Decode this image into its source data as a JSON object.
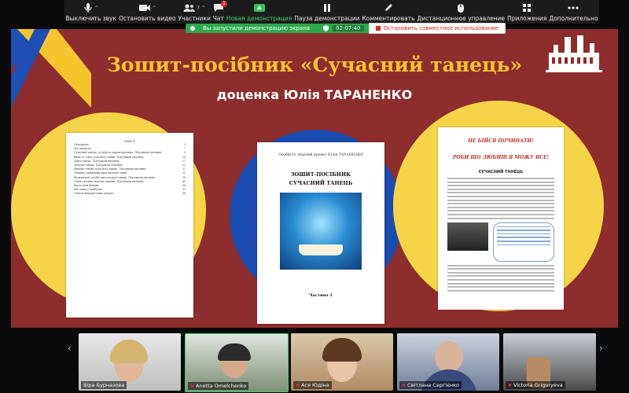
{
  "toolbar": {
    "items": [
      {
        "label": "Выключить звук",
        "icon": "microphone-icon"
      },
      {
        "label": "Остановить видео",
        "icon": "camera-icon"
      },
      {
        "label": "Участники",
        "icon": "participants-icon",
        "count": "7"
      },
      {
        "label": "Чат",
        "icon": "chat-icon",
        "badge": "1"
      },
      {
        "label": "Новая демонстрация",
        "icon": "share-screen-icon"
      },
      {
        "label": "Пауза демонстрации",
        "icon": "pause-icon"
      },
      {
        "label": "Комментировать",
        "icon": "annotate-icon"
      },
      {
        "label": "Дистанционное управление",
        "icon": "remote-control-icon"
      },
      {
        "label": "Приложения",
        "icon": "apps-icon"
      },
      {
        "label": "Дополнительно",
        "icon": "more-icon"
      }
    ]
  },
  "sharebar": {
    "status": "Вы запустили демонстрацию экрана",
    "timer": "02:07:40",
    "stop_label": "Остановить совместное использование"
  },
  "slide": {
    "title": "Зошит-посібник «Сучасний танець»",
    "subtitle": "доценка Юлія ТАРАНЕНКО",
    "colors": {
      "background": "#8e2d2d",
      "title": "#f6c52e",
      "circle_yellow": "#f6d447",
      "circle_blue": "#1b4cb0"
    },
    "toc": {
      "heading": "ЗМІСТ",
      "lines": [
        [
          "Передмова",
          "3"
        ],
        [
          "Мої джерела",
          "7"
        ],
        [
          "Сучасний танець: історія та характеристика. Підсумкові питання",
          "9"
        ],
        [
          "Види та стилі сучасного танцю. Підсумкові питання",
          "14"
        ],
        [
          "Джаз-танець. Підсумкові питання",
          "17"
        ],
        [
          "Модерн-танець. Підсумкові питання",
          "22"
        ],
        [
          "Фізичні основи сучасного танцю. Підсумкові питання",
          "27"
        ],
        [
          "Техніки і принципи джаз-модерн танцю",
          "31"
        ],
        [
          "Виражальні засоби джаз-модерн танцю. Підсумкові питання",
          "38"
        ],
        [
          "Серія рухових творчих завдань. Підсумкові питання",
          "43"
        ],
        [
          "Карта моїх бажань",
          "54"
        ],
        [
          "Мої танці у майбутнє",
          "55"
        ],
        [
          "Список використаних джерел",
          "56"
        ]
      ]
    },
    "cover": {
      "author": "Особисто творчий проект Юлія ТАРАНЕНКО",
      "book_title_1": "ЗОШИТ-ПОСІБНИК",
      "book_title_2": "СУЧАСНИЙ ТАНЕЦЬ",
      "part": "Частина 1"
    },
    "right_page": {
      "heading_1": "НЕ БІЙСЯ ПОЧИНАТИ!",
      "heading_2": "РОБИ ЩО ЛЮБИШ Я МОЖУ ВСЕ!",
      "section": "СУЧАСНИЙ ТАНЕЦЬ"
    }
  },
  "participants": [
    {
      "name": "Віра Бурназова",
      "muted": false
    },
    {
      "name": "Anetta Omelchenko",
      "muted": true
    },
    {
      "name": "Ася Юдіна",
      "muted": true
    },
    {
      "name": "Світлана Сергієнко",
      "muted": true
    },
    {
      "name": "Victoria Grigoryeva",
      "muted": true
    }
  ]
}
